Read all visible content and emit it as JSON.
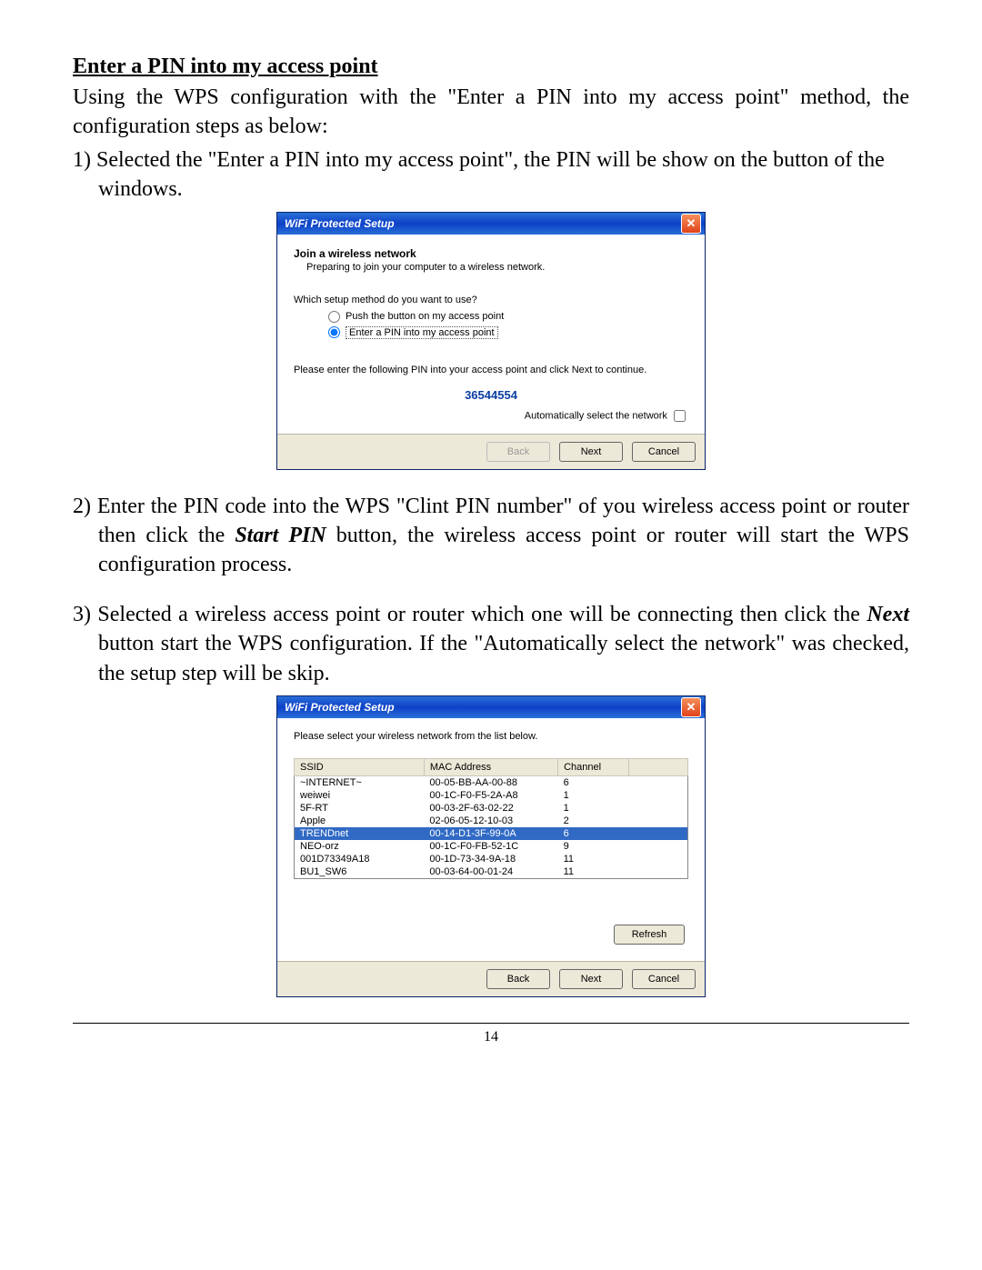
{
  "page_number": "14",
  "section_title": "Enter a PIN into my access point",
  "intro": "Using the WPS configuration with the \"Enter a PIN into my access point\" method, the configuration steps as below:",
  "step1": "1) Selected the \"Enter a PIN into my access point\", the PIN will be show on the button of the windows.",
  "step2_a": "2) Enter the PIN code into the WPS \"Clint PIN number\" of you wireless access point or router then click the  ",
  "step2_bold": "Start PIN",
  "step2_b": " button, the wireless access point or router will start the WPS configuration process.",
  "step3_a": "3) Selected a wireless access point or router which one will be connecting then click the ",
  "step3_bold": "Next",
  "step3_b": " button start the WPS configuration. If the \"Automatically select the network\" was checked, the setup step will be skip.",
  "dialog1": {
    "title": "WiFi Protected Setup",
    "heading": "Join a wireless network",
    "subheading": "Preparing to join your computer to a wireless network.",
    "question": "Which setup method do you want to use?",
    "radio1": "Push the button on my access point",
    "radio2": "Enter a PIN into my access point",
    "instruction": "Please enter the following PIN into your access point and click Next to continue.",
    "pin": "36544554",
    "auto_label": "Automatically select the network",
    "back": "Back",
    "next": "Next",
    "cancel": "Cancel"
  },
  "dialog2": {
    "title": "WiFi Protected Setup",
    "instruction": "Please select your wireless network from the list below.",
    "col_ssid": "SSID",
    "col_mac": "MAC Address",
    "col_channel": "Channel",
    "rows": [
      {
        "ssid": "~INTERNET~",
        "mac": "00-05-BB-AA-00-88",
        "ch": "6"
      },
      {
        "ssid": "weiwei",
        "mac": "00-1C-F0-F5-2A-A8",
        "ch": "1"
      },
      {
        "ssid": "5F-RT",
        "mac": "00-03-2F-63-02-22",
        "ch": "1"
      },
      {
        "ssid": "Apple",
        "mac": "02-06-05-12-10-03",
        "ch": "2"
      },
      {
        "ssid": "TRENDnet",
        "mac": "00-14-D1-3F-99-0A",
        "ch": "6"
      },
      {
        "ssid": "NEO-orz",
        "mac": "00-1C-F0-FB-52-1C",
        "ch": "9"
      },
      {
        "ssid": "001D73349A18",
        "mac": "00-1D-73-34-9A-18",
        "ch": "11"
      },
      {
        "ssid": "BU1_SW6",
        "mac": "00-03-64-00-01-24",
        "ch": "11"
      }
    ],
    "refresh": "Refresh",
    "back": "Back",
    "next": "Next",
    "cancel": "Cancel"
  }
}
